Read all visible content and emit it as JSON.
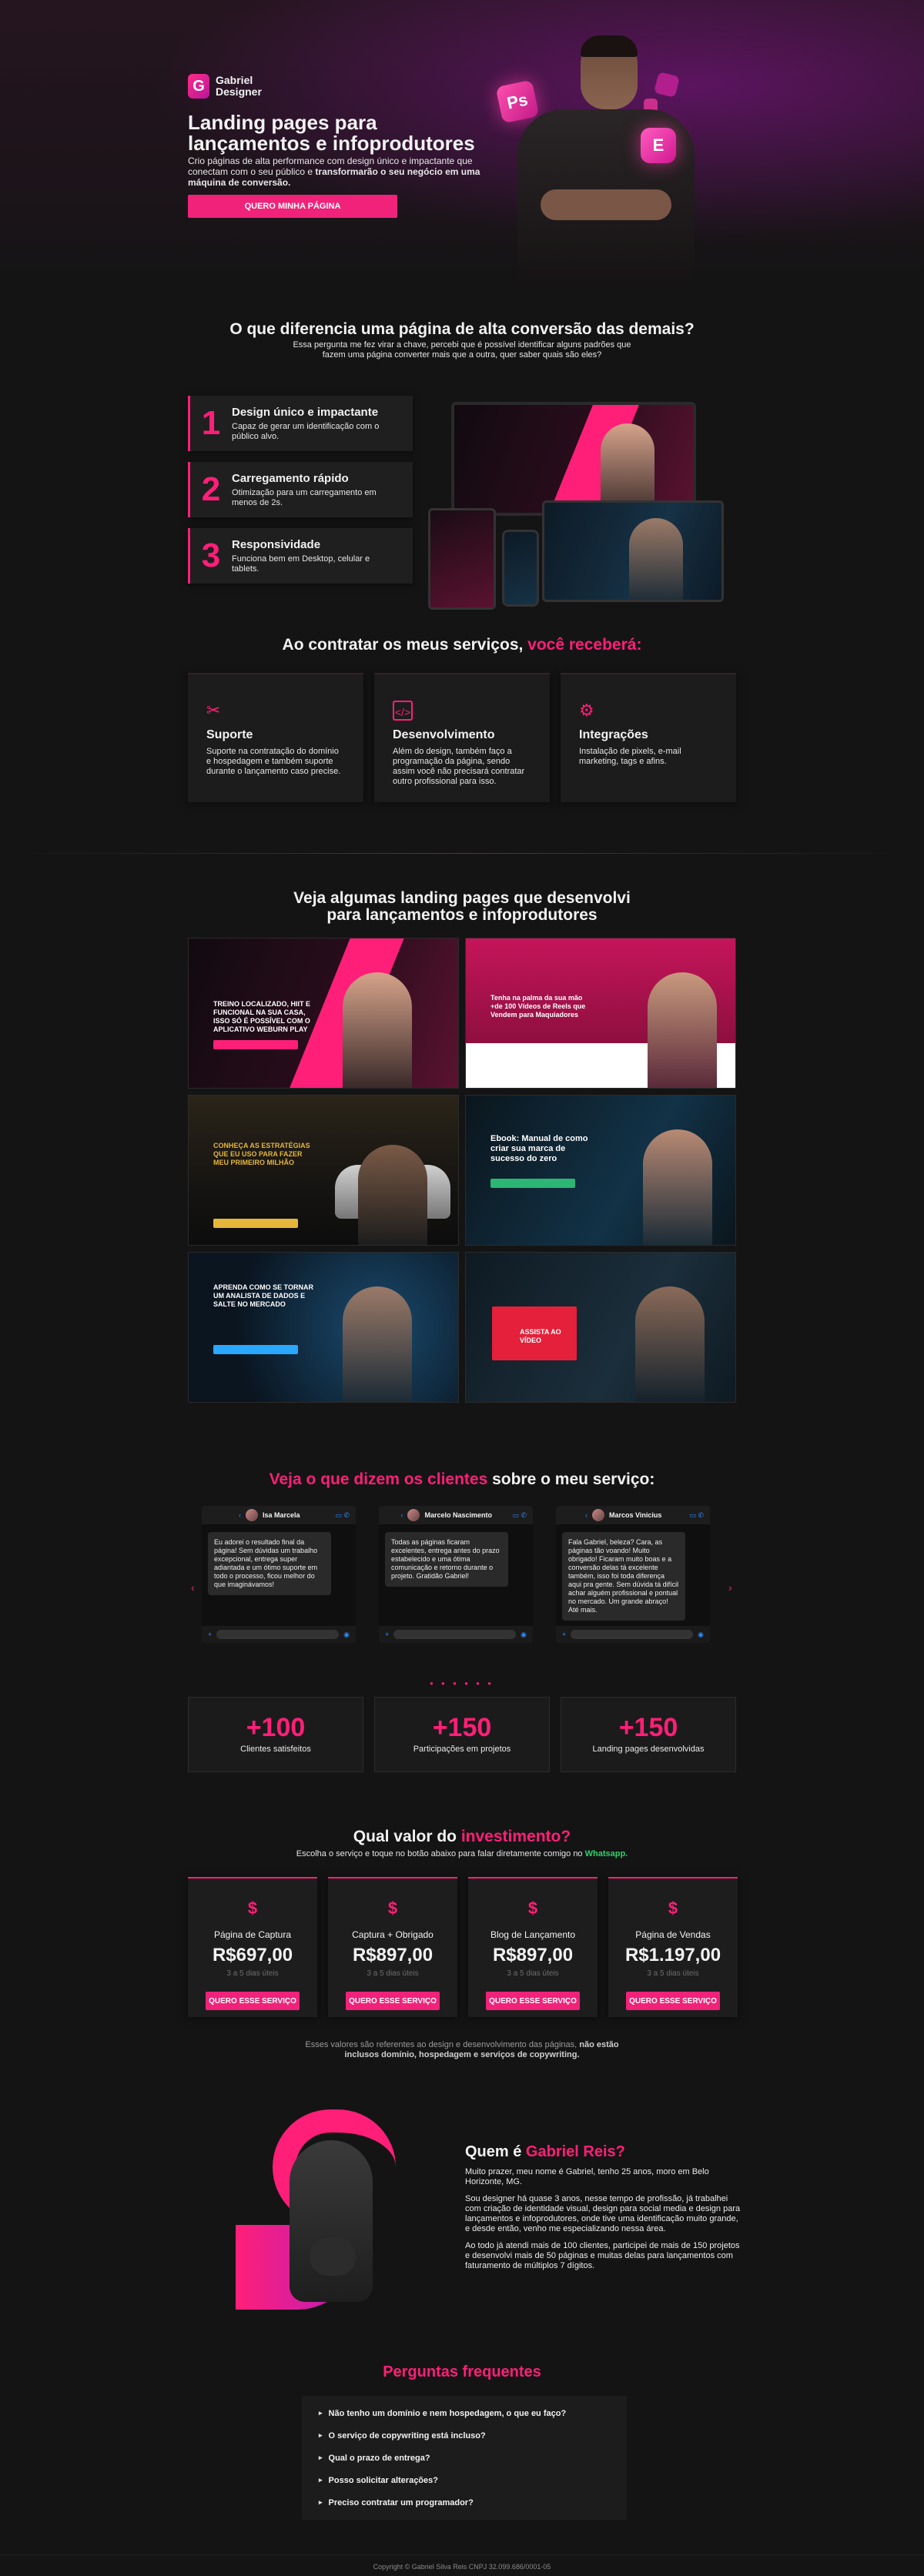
{
  "hero": {
    "logo_letter": "G",
    "logo_line1": "Gabriel",
    "logo_line2": "Designer",
    "title_line1": "Landing pages para",
    "title_line2": "lançamentos e infoprodutores",
    "subtitle_a": "Crio páginas de alta performance com design único e impactante que conectam com o seu público e ",
    "subtitle_b": "transformarão o seu negócio em uma máquina de conversão.",
    "cta": "QUERO MINHA PÁGINA",
    "badge_ps": "Ps",
    "badge_e": "E"
  },
  "differential": {
    "title": "O que diferencia uma página de alta conversão das demais?",
    "subtitle_1": "Essa pergunta me fez virar a chave, percebi que é possível identificar alguns padrões que",
    "subtitle_2": "fazem uma página converter mais que a outra, quer saber quais são eles?",
    "items": [
      {
        "num": "1",
        "title": "Design único e impactante",
        "text": "Capaz de gerar um identificação com o público alvo."
      },
      {
        "num": "2",
        "title": "Carregamento rápido",
        "text": "Otimização para um carregamento em menos de 2s."
      },
      {
        "num": "3",
        "title": "Responsividade",
        "text": "Funciona bem em Desktop, celular e tablets."
      }
    ]
  },
  "services": {
    "title_a": "Ao contratar os meus serviços, ",
    "title_b": "você receberá:",
    "items": [
      {
        "icon": "✂",
        "title": "Suporte",
        "text": "Suporte na contratação do domínio e hospedagem e também suporte durante o lançamento caso precise."
      },
      {
        "icon": "</>",
        "title": "Desenvolvimento",
        "text": "Além do design, também faço a programação da página, sendo assim você não precisará contratar outro profissional para isso."
      },
      {
        "icon": "⚙",
        "title": "Integrações",
        "text": "Instalação de pixels, e-mail marketing, tags e afins."
      }
    ]
  },
  "portfolio": {
    "title_1": "Veja algumas landing pages que desenvolvi",
    "title_2": "para lançamentos e infoprodutores",
    "items": [
      {
        "caption": "TREINO LOCALIZADO, HIIT E FUNCIONAL NA SUA CASA, ISSO SÓ É POSSÍVEL COM O APLICATIVO WEBURN PLAY",
        "bg": "#1a0c12",
        "accent": "#ff1f78"
      },
      {
        "caption": "Tenha na palma da sua mão +de 100 Vídeos de Reels que Vendem para Maquiadores",
        "bg": "#b0124c",
        "accent": "#ffffff"
      },
      {
        "caption": "CONHEÇA AS ESTRATÉGIAS QUE EU USO PARA FAZER MEU PRIMEIRO MILHÃO",
        "bg": "#1c1a16",
        "accent": "#e5b63a"
      },
      {
        "caption": "Ebook: Manual de como criar sua marca de sucesso do zero",
        "bg": "#0c1a22",
        "accent": "#2bb673"
      },
      {
        "caption": "APRENDA COMO SE TORNAR UM ANALISTA DE DADOS E SALTE NO MERCADO",
        "bg": "#0b1824",
        "accent": "#2aa7ff"
      },
      {
        "caption": "ASSISTA AO VÍDEO",
        "bg": "#0f1a22",
        "accent": "#e5203a"
      }
    ]
  },
  "testimonials": {
    "title_a": "Veja o que dizem os clientes",
    "title_b": " sobre o meu serviço:",
    "chats": [
      {
        "name": "Isa Marcela",
        "message": "Eu adorei o resultado final da página! Sem dúvidas um trabalho excepcional, entrega super adiantada e um ótimo suporte em todo o processo, ficou melhor do que imaginávamos!"
      },
      {
        "name": "Marcelo Nascimento",
        "message": "Todas as páginas ficaram excelentes, entrega antes do prazo estabelecido e uma ótima comunicação e retorno durante o projeto. Gratidão Gabriel!"
      },
      {
        "name": "Marcos Vinicius",
        "message": "Fala Gabriel, beleza? Cara, as páginas tão voando! Muito obrigado! Ficaram muito boas e a conversão delas tá excelente também, isso foi toda diferença aqui pra gente. Sem dúvida tá difícil achar alguém profissional e pontual no mercado. Um grande abraço! Até mais."
      }
    ],
    "prev": "‹",
    "next": "›",
    "dots": "● ● ● ● ● ●"
  },
  "stats": [
    {
      "value": "+100",
      "label": "Clientes satisfeitos"
    },
    {
      "value": "+150",
      "label": "Participações em projetos"
    },
    {
      "value": "+150",
      "label": "Landing pages desenvolvidas"
    }
  ],
  "pricing": {
    "title_a": "Qual valor do ",
    "title_b": "investimento?",
    "sub_a": "Escolha o serviço e toque no botão abaixo para falar diretamente comigo no ",
    "sub_b": "Whatsapp.",
    "items": [
      {
        "icon": "$",
        "name": "Página de Captura",
        "price": "R$697,00",
        "days": "3 a 5 dias úteis",
        "cta": "QUERO ESSE SERVIÇO"
      },
      {
        "icon": "$",
        "name": "Captura + Obrigado",
        "price": "R$897,00",
        "days": "3 a 5 dias úteis",
        "cta": "QUERO ESSE SERVIÇO"
      },
      {
        "icon": "$",
        "name": "Blog de Lançamento",
        "price": "R$897,00",
        "days": "3 a 5 dias úteis",
        "cta": "QUERO ESSE SERVIÇO"
      },
      {
        "icon": "$",
        "name": "Página de Vendas",
        "price": "R$1.197,00",
        "days": "3 a 5 dias úteis",
        "cta": "QUERO ESSE SERVIÇO"
      }
    ],
    "note_a": "Esses valores são referentes ao design e desenvolvimento das páginas, ",
    "note_b": "não estão inclusos domínio, hospedagem e serviços de copywriting."
  },
  "about": {
    "title_a": "Quem é ",
    "title_b": "Gabriel Reis?",
    "p1": "Muito prazer, meu nome é Gabriel, tenho 25 anos, moro em Belo Horizonte, MG.",
    "p2": "Sou designer há quase 3 anos, nesse tempo de profissão, já trabalhei com criação de identidade visual, design para social media e design para lançamentos e infoprodutores, onde tive uma identificação muito grande, e desde então, venho me especializando nessa área.",
    "p3": "Ao todo já atendi mais de 100 clientes, participei de mais de 150 projetos e desenvolvi mais de 50 páginas e muitas delas para lançamentos com faturamento de múltiplos 7 dígitos."
  },
  "faq": {
    "title": "Perguntas frequentes",
    "items": [
      "Não tenho um domínio e nem hospedagem, o que eu faço?",
      "O serviço de copywriting está incluso?",
      "Qual o prazo de entrega?",
      "Posso solicitar alterações?",
      "Preciso contratar um programador?"
    ]
  },
  "footer": "Copyright © Gabriel Silva Reis CNPJ 32.099.686/0001-05"
}
